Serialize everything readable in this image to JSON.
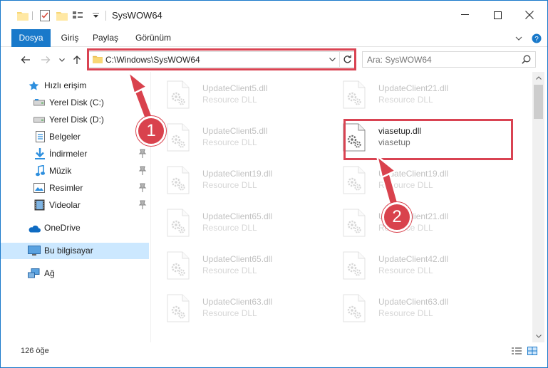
{
  "window": {
    "title": "SysWOW64",
    "controls": [
      "minimize",
      "maximize",
      "close"
    ]
  },
  "ribbon": {
    "tabs": [
      "Dosya",
      "Giriş",
      "Paylaş",
      "Görünüm"
    ]
  },
  "address": {
    "path": "C:\\Windows\\SysWOW64"
  },
  "search": {
    "placeholder": "Ara: SysWOW64"
  },
  "nav": {
    "items": [
      {
        "label": "Hızlı erişim",
        "icon": "star-icon",
        "pinned": false
      },
      {
        "label": "Yerel Disk (C:)",
        "icon": "drive-icon",
        "pinned": true
      },
      {
        "label": "Yerel Disk (D:)",
        "icon": "drive-icon",
        "pinned": true
      },
      {
        "label": "Belgeler",
        "icon": "document-icon",
        "pinned": true
      },
      {
        "label": "İndirmeler",
        "icon": "download-icon",
        "pinned": true
      },
      {
        "label": "Müzik",
        "icon": "music-icon",
        "pinned": true
      },
      {
        "label": "Resimler",
        "icon": "pictures-icon",
        "pinned": true
      },
      {
        "label": "Videolar",
        "icon": "video-icon",
        "pinned": true
      },
      {
        "label": "OneDrive",
        "icon": "cloud-icon",
        "pinned": false
      },
      {
        "label": "Bu bilgisayar",
        "icon": "computer-icon",
        "pinned": false,
        "selected": true
      },
      {
        "label": "Ağ",
        "icon": "network-icon",
        "pinned": false
      }
    ]
  },
  "files": {
    "left": [
      {
        "name": "UpdateClient5.dll",
        "type": "Resource DLL"
      },
      {
        "name": "UpdateClient5.dll",
        "type": "Resource DLL"
      },
      {
        "name": "UpdateClient19.dll",
        "type": "Resource DLL"
      },
      {
        "name": "UpdateClient65.dll",
        "type": "Resource DLL"
      },
      {
        "name": "UpdateClient65.dll",
        "type": "Resource DLL"
      },
      {
        "name": "UpdateClient63.dll",
        "type": "Resource DLL"
      }
    ],
    "right": [
      {
        "name": "UpdateClient21.dll",
        "type": "Resource DLL"
      },
      {
        "name": "viasetup.dll",
        "type": "viasetup",
        "highlighted": true
      },
      {
        "name": "UpdateClient19.dll",
        "type": "Resource DLL"
      },
      {
        "name": "UpdateClient21.dll",
        "type": "Resource DLL"
      },
      {
        "name": "UpdateClient42.dll",
        "type": "Resource DLL"
      },
      {
        "name": "UpdateClient63.dll",
        "type": "Resource DLL"
      }
    ]
  },
  "status": {
    "count": "126 öğe"
  },
  "annotations": {
    "step1": "1",
    "step2": "2",
    "color": "#d9424d"
  },
  "colors": {
    "accent": "#1979ca",
    "selected": "#cce8ff",
    "highlight": "#d94352"
  }
}
